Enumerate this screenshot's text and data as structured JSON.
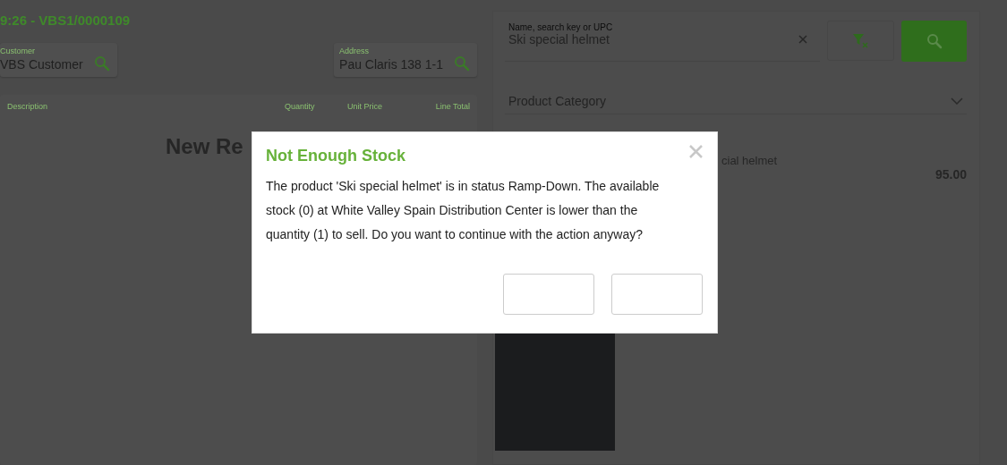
{
  "header": {
    "title": "9:26 - VBS1/0000109"
  },
  "customer": {
    "label": "Customer",
    "value": "VBS Customer"
  },
  "address": {
    "label": "Address",
    "value": "Pau Claris 138 1-1"
  },
  "lines_table": {
    "columns": [
      "Description",
      "Quantity",
      "Unit Price",
      "Line Total"
    ],
    "empty_text": "New Re"
  },
  "product_search": {
    "label": "Name, search key or UPC",
    "value": "Ski special helmet",
    "category": {
      "placeholder": "Product Category"
    }
  },
  "products": [
    {
      "name": "cial helmet",
      "price": "95.00"
    }
  ],
  "dialog": {
    "title": "Not Enough Stock",
    "message": "The product 'Ski special helmet' is in status Ramp-Down. The available stock (0) at White Valley Spain Distribution Center is lower than the quantity (1) to sell. Do you want to continue with the action anyway?",
    "buttons": [
      {
        "kind": "blank"
      },
      {
        "kind": "blank"
      }
    ]
  }
}
